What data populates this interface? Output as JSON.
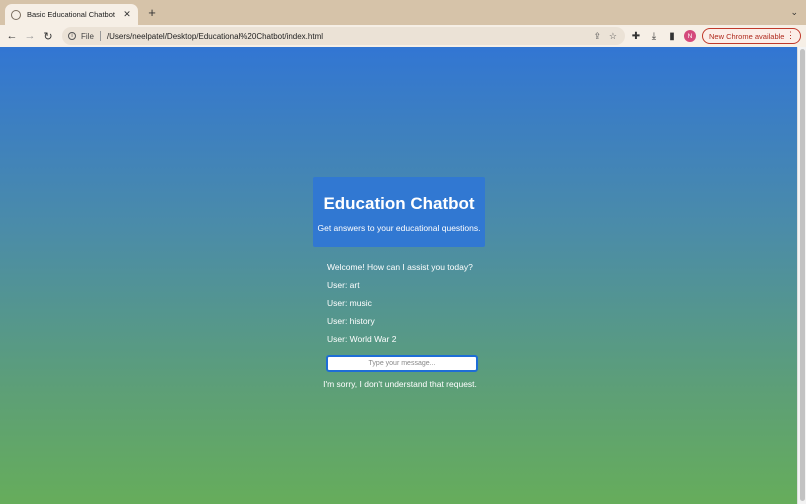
{
  "browser": {
    "tab": {
      "title": "Basic Educational Chatbot"
    },
    "address": {
      "scheme": "File",
      "url": "/Users/neelpatel/Desktop/Educational%20Chatbot/index.html"
    },
    "profile_initial": "N",
    "update_button": "New Chrome available"
  },
  "page": {
    "header": {
      "title": "Education Chatbot",
      "subtitle": "Get answers to your educational questions."
    },
    "messages": [
      "Welcome! How can I assist you today?",
      "User: art",
      "User: music",
      "User: history",
      "User: World War 2"
    ],
    "input": {
      "placeholder": "Type your message...",
      "value": ""
    },
    "response": "I'm sorry, I don't understand that request."
  },
  "colors": {
    "accent": "#3178d2",
    "gradient_top": "#3276d3",
    "gradient_bottom": "#66ad5b",
    "update_red": "#b02a1e"
  }
}
